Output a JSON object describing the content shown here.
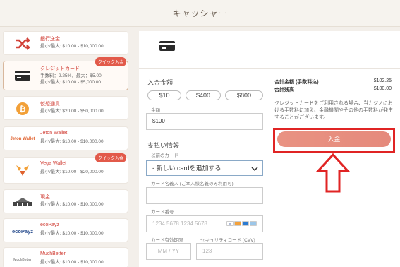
{
  "header": {
    "title": "キャッシャー"
  },
  "methods": [
    {
      "name": "銀行送金",
      "limit": "最小/最大: $10.00 - $10,000.00"
    },
    {
      "name": "クレジットカード",
      "limit": "手数料：2.25%，最大：$5.00",
      "limit2": "最小/最大: $10.00 - $5,000.00",
      "badge": "クイック入金"
    },
    {
      "name": "仮想通貨",
      "limit": "最小/最大: $20.00 - $50,000.00"
    },
    {
      "name": "Jeton Wallet",
      "limit": "最小/最大: $10.00 - $10,000.00",
      "logo": "Jeton Wallet"
    },
    {
      "name": "Vega Wallet",
      "limit": "最小/最大: $10.00 - $20,000.00",
      "badge": "クイック入金"
    },
    {
      "name": "現金",
      "limit": "最小/最大: $10.00 - $10,000.00"
    },
    {
      "name": "ecoPayz",
      "limit": "最小/最大: $10.00 - $10,000.00",
      "logo": "ecoPayz"
    },
    {
      "name": "MuchBetter",
      "limit": "最小/最大: $10.00 - $10,000.00",
      "logo": "MuchBetter"
    }
  ],
  "form": {
    "deposit_amount_label": "入金金額",
    "quick_amounts": [
      "$10",
      "$400",
      "$800"
    ],
    "amount_label": "金額",
    "amount_value": "$100",
    "payment_info_label": "支払い情報",
    "prev_card_label": "以前のカード",
    "card_select_value": "- 新しい cardを追加する",
    "cardholder_label": "カード名義人 (ご本人様名義のみ利用可)",
    "card_number_label": "カード番号",
    "card_number_placeholder": "1234 5678 1234 5678",
    "expiry_label": "カード有効期限",
    "expiry_placeholder": "MM / YY",
    "cvv_label": "セキュリティコード (CVV)",
    "cvv_placeholder": "123"
  },
  "summary": {
    "total_label": "合計金額 (手数料込)",
    "total_value": "$102.25",
    "balance_label": "合計残高",
    "balance_value": "$100.00",
    "note": "クレジットカードをご利用される場合、当カジノにおける手数料に加え、金融機関やその他の手数料が発生することがございます。",
    "deposit_button": "入金"
  },
  "colors": {
    "accent": "#e58a7c",
    "highlight": "#e02424",
    "method_name": "#d2433a",
    "badge": "#e25a4a"
  },
  "icons": [
    "shuffle-icon",
    "credit-card-icon",
    "bitcoin-icon",
    "jeton-logo",
    "vega-icon",
    "cash-icon",
    "ecopayz-logo",
    "muchbetter-logo",
    "chevron-down-icon",
    "up-arrow-icon"
  ]
}
